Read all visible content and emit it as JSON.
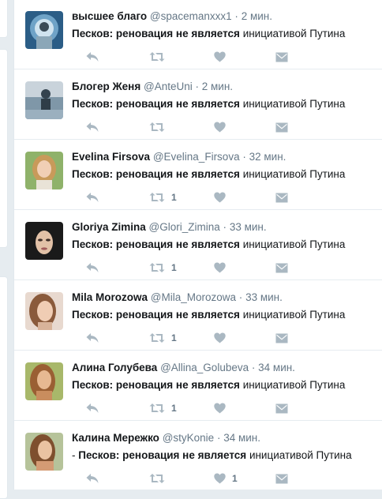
{
  "tweets": [
    {
      "name": "высшее благо",
      "handle": "@spacemanxxx1",
      "time": "2 мин.",
      "prefix": "",
      "bold": "Песков: реновация не является",
      "rest": " инициативой Путина",
      "retweets": "",
      "likes": ""
    },
    {
      "name": "Блогер Женя",
      "handle": "@AnteUni",
      "time": "2 мин.",
      "prefix": "",
      "bold": "Песков: реновация не является",
      "rest": " инициативой Путина",
      "retweets": "",
      "likes": ""
    },
    {
      "name": "Evelina Firsova",
      "handle": "@Evelina_Firsova",
      "time": "32 мин.",
      "prefix": "",
      "bold": "Песков: реновация не является",
      "rest": " инициативой Путина",
      "retweets": "1",
      "likes": ""
    },
    {
      "name": "Gloriya Zimina",
      "handle": "@Glori_Zimina",
      "time": "33 мин.",
      "prefix": "",
      "bold": "Песков: реновация не является",
      "rest": " инициативой Путина",
      "retweets": "1",
      "likes": ""
    },
    {
      "name": "Mila Morozowa",
      "handle": "@Mila_Morozowa",
      "time": "33 мин.",
      "prefix": "",
      "bold": "Песков: реновация не является",
      "rest": " инициативой Путина",
      "retweets": "1",
      "likes": ""
    },
    {
      "name": "Алина Голубева",
      "handle": "@Allina_Golubeva",
      "time": "34 мин.",
      "prefix": "",
      "bold": "Песков: реновация не является",
      "rest": " инициативой Путина",
      "retweets": "1",
      "likes": ""
    },
    {
      "name": "Калина Мережко",
      "handle": "@styKonie",
      "time": "34 мин.",
      "prefix": "- ",
      "bold": "Песков: реновация не является",
      "rest": " инициативой Путина",
      "retweets": "",
      "likes": "1"
    }
  ],
  "colors": {
    "name": "#14171a",
    "meta": "#657786",
    "icon": "#aab8c2",
    "divider": "#e6ecf0"
  },
  "icons": {
    "reply": "reply-icon",
    "retweet": "retweet-icon",
    "like": "heart-icon",
    "dm": "direct-message-icon"
  }
}
